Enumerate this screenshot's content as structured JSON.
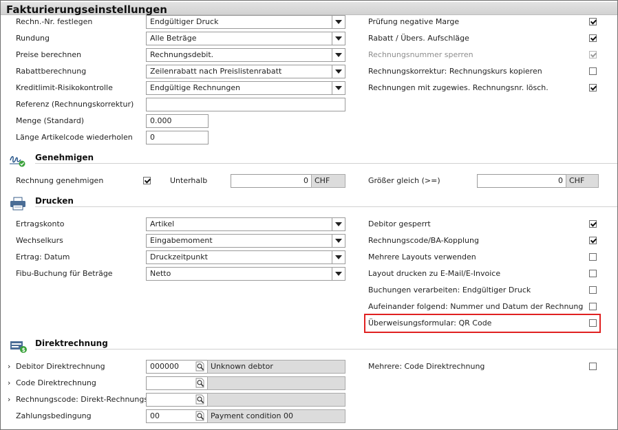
{
  "window": {
    "title": "Fakturierungseinstellungen"
  },
  "general": {
    "rechn_nr_label": "Rechn.-Nr. festlegen",
    "rechn_nr_value": "Endgültiger Druck",
    "rundung_label": "Rundung",
    "rundung_value": "Alle Beträge",
    "preise_label": "Preise berechnen",
    "preise_value": "Rechnungsdebit.",
    "rabatt_label": "Rabattberechnung",
    "rabatt_value": "Zeilenrabatt nach Preislistenrabatt",
    "kredit_label": "Kreditlimit-Risikokontrolle",
    "kredit_value": "Endgültige Rechnungen",
    "referenz_label": "Referenz (Rechnungskorrektur)",
    "referenz_value": "",
    "menge_label": "Menge (Standard)",
    "menge_value": "0.000",
    "laenge_label": "Länge Artikelcode wiederholen",
    "laenge_value": "0",
    "pruefung_label": "Prüfung negative Marge",
    "pruefung_checked": true,
    "rabatt_aufschlaege_label": "Rabatt / Übers. Aufschläge",
    "rabatt_aufschlaege_checked": true,
    "sperren_label": "Rechnungsnummer sperren",
    "sperren_checked": true,
    "korrektur_label": "Rechnungskorrektur: Rechnungskurs kopieren",
    "korrektur_checked": false,
    "loeschen_label": "Rechnungen mit zugewies. Rechnungsnr. lösch.",
    "loeschen_checked": true
  },
  "genehmigen": {
    "title": "Genehmigen",
    "rechnung_label": "Rechnung genehmigen",
    "rechnung_checked": true,
    "unterhalb_label": "Unterhalb",
    "unterhalb_value": "0",
    "unterhalb_currency": "CHF",
    "groesser_label": "Größer gleich (>=)",
    "groesser_value": "0",
    "groesser_currency": "CHF"
  },
  "drucken": {
    "title": "Drucken",
    "ertragskonto_label": "Ertragskonto",
    "ertragskonto_value": "Artikel",
    "wechselkurs_label": "Wechselkurs",
    "wechselkurs_value": "Eingabemoment",
    "ertrag_datum_label": "Ertrag: Datum",
    "ertrag_datum_value": "Druckzeitpunkt",
    "fibu_label": "Fibu-Buchung für Beträge",
    "fibu_value": "Netto",
    "debitor_gesperrt_label": "Debitor gesperrt",
    "debitor_gesperrt_checked": true,
    "kopplung_label": "Rechnungscode/BA-Kopplung",
    "kopplung_checked": true,
    "layouts_label": "Mehrere Layouts verwenden",
    "layouts_checked": false,
    "email_label": "Layout drucken zu E-Mail/E-Invoice",
    "email_checked": false,
    "buchungen_label": "Buchungen verarbeiten: Endgültiger Druck",
    "buchungen_checked": false,
    "aufeinander_label": "Aufeinander folgend: Nummer und Datum der Rechnung",
    "aufeinander_checked": false,
    "qr_label": "Überweisungsformular: QR Code",
    "qr_checked": false
  },
  "direkt": {
    "title": "Direktrechnung",
    "debitor_label": "Debitor Direktrechnung",
    "debitor_code": "000000",
    "debitor_desc": "Unknown debtor",
    "code_label": "Code Direktrechnung",
    "code_value": "",
    "code_desc": "",
    "rcode_label": "Rechnungscode: Direkt-Rechnungsko",
    "rcode_value": "",
    "rcode_desc": "",
    "zahlung_label": "Zahlungsbedingung",
    "zahlung_code": "00",
    "zahlung_desc": "Payment condition 00",
    "mehrere_label": "Mehrere: Code Direktrechnung",
    "mehrere_checked": false
  },
  "colors": {
    "highlight": "#e02020",
    "readonly_bg": "#dcdcdc",
    "border": "#9a9a9a"
  },
  "icons": {
    "approve": "signature-check-icon",
    "print": "printer-icon",
    "direct": "invoice-money-icon",
    "lookup": "magnifier-page-icon",
    "expand": "chevron-right-icon"
  }
}
